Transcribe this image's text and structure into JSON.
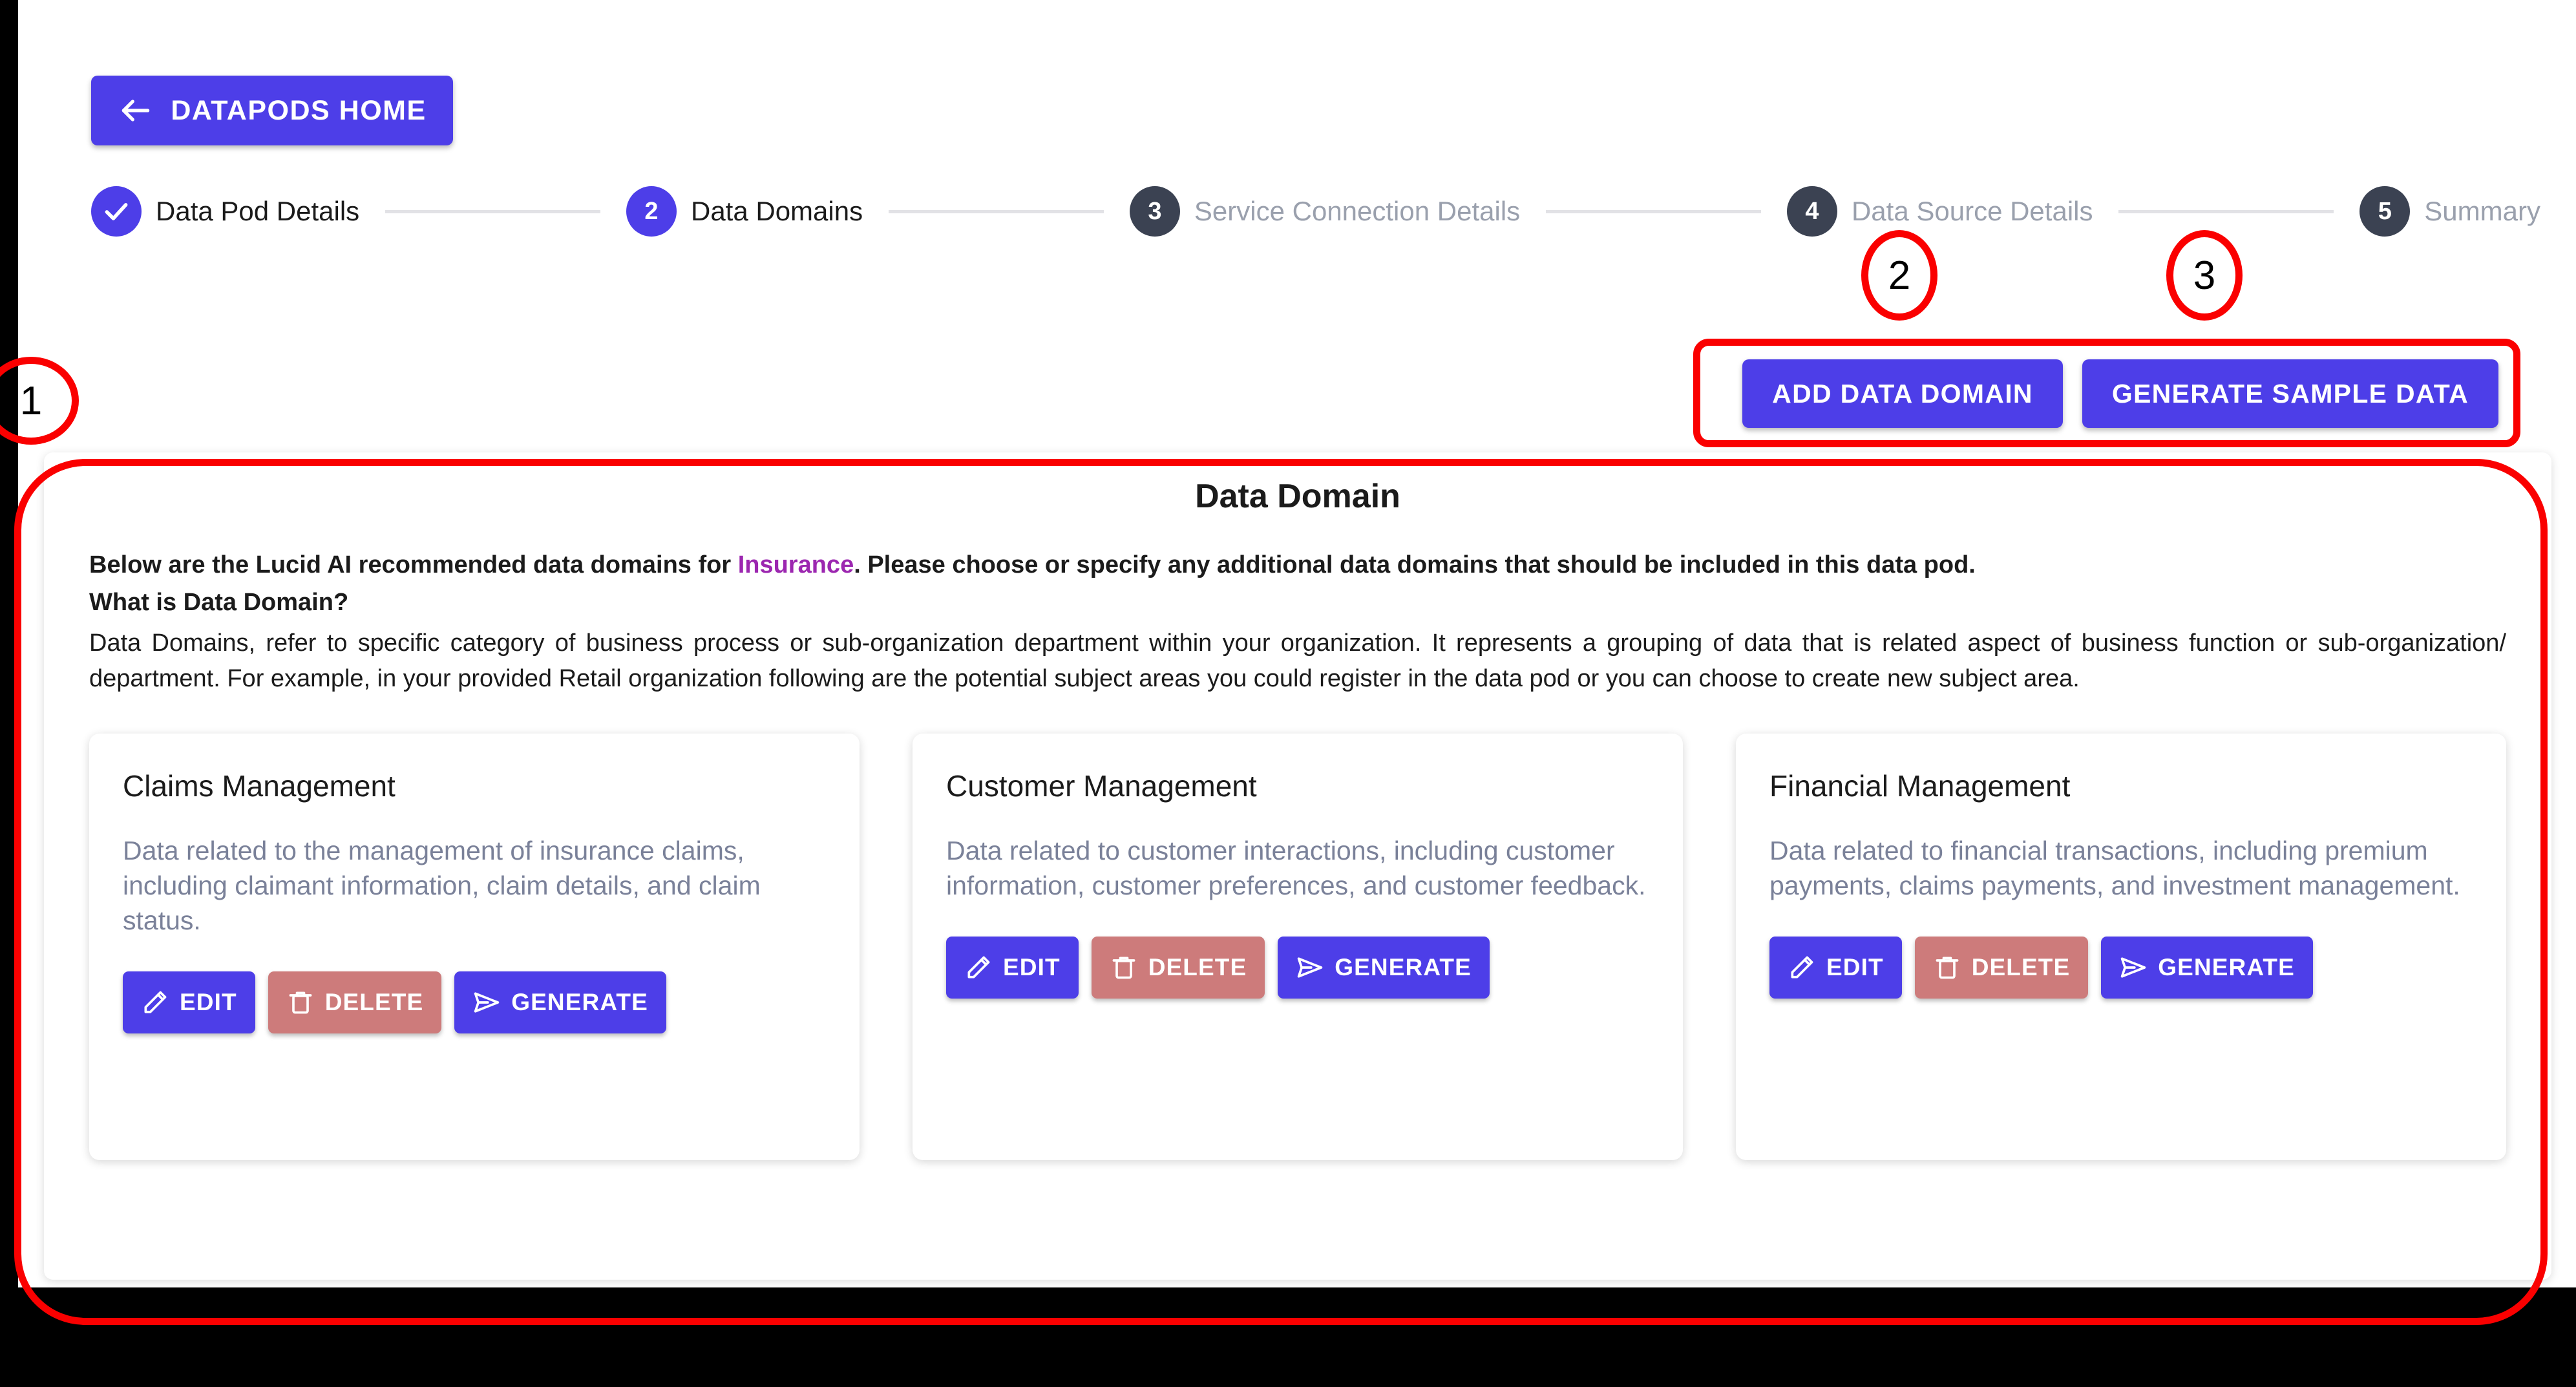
{
  "header": {
    "home_button_label": "DATAPODS HOME",
    "back_arrow_icon": "arrow-left-icon"
  },
  "stepper": {
    "steps": [
      {
        "num": "1",
        "label": "Data Pod Details",
        "state": "done"
      },
      {
        "num": "2",
        "label": "Data Domains",
        "state": "active"
      },
      {
        "num": "3",
        "label": "Service Connection Details",
        "state": "idle"
      },
      {
        "num": "4",
        "label": "Data Source Details",
        "state": "idle"
      },
      {
        "num": "5",
        "label": "Summary",
        "state": "idle"
      }
    ]
  },
  "toolbar": {
    "add_data_domain_label": "ADD DATA DOMAIN",
    "generate_sample_data_label": "GENERATE SAMPLE DATA"
  },
  "panel": {
    "title": "Data Domain",
    "lead_prefix": "Below are the Lucid AI recommended data domains for ",
    "lead_highlight": "Insurance",
    "lead_suffix": ". Please choose or specify any additional data domains that should be included in this data pod.",
    "sub_heading": "What is Data Domain?",
    "body": "Data Domains, refer to specific category of business process or sub-organization department within your organization. It represents a grouping of data that is related aspect of business function or sub-organization/ department. For example, in your provided Retail organization following are the potential subject areas you could register in the data pod or you can choose to create new subject area."
  },
  "buttons": {
    "edit_label": "EDIT",
    "delete_label": "DELETE",
    "generate_label": "GENERATE"
  },
  "domains": [
    {
      "title": "Claims Management",
      "description": "Data related to the management of insurance claims, including claimant information, claim details, and claim status."
    },
    {
      "title": "Customer Management",
      "description": "Data related to customer interactions, including customer information, customer preferences, and customer feedback."
    },
    {
      "title": "Financial Management",
      "description": "Data related to financial transactions, including premium payments, claims payments, and investment management."
    }
  ],
  "annotations": {
    "marker_1": "1",
    "marker_2": "2",
    "marker_3": "3"
  },
  "colors": {
    "primary": "#4d3ee8",
    "danger": "#cd7b7b",
    "highlight": "#9c27b0",
    "step_idle": "#3b4252",
    "annotation": "#fa0000"
  }
}
